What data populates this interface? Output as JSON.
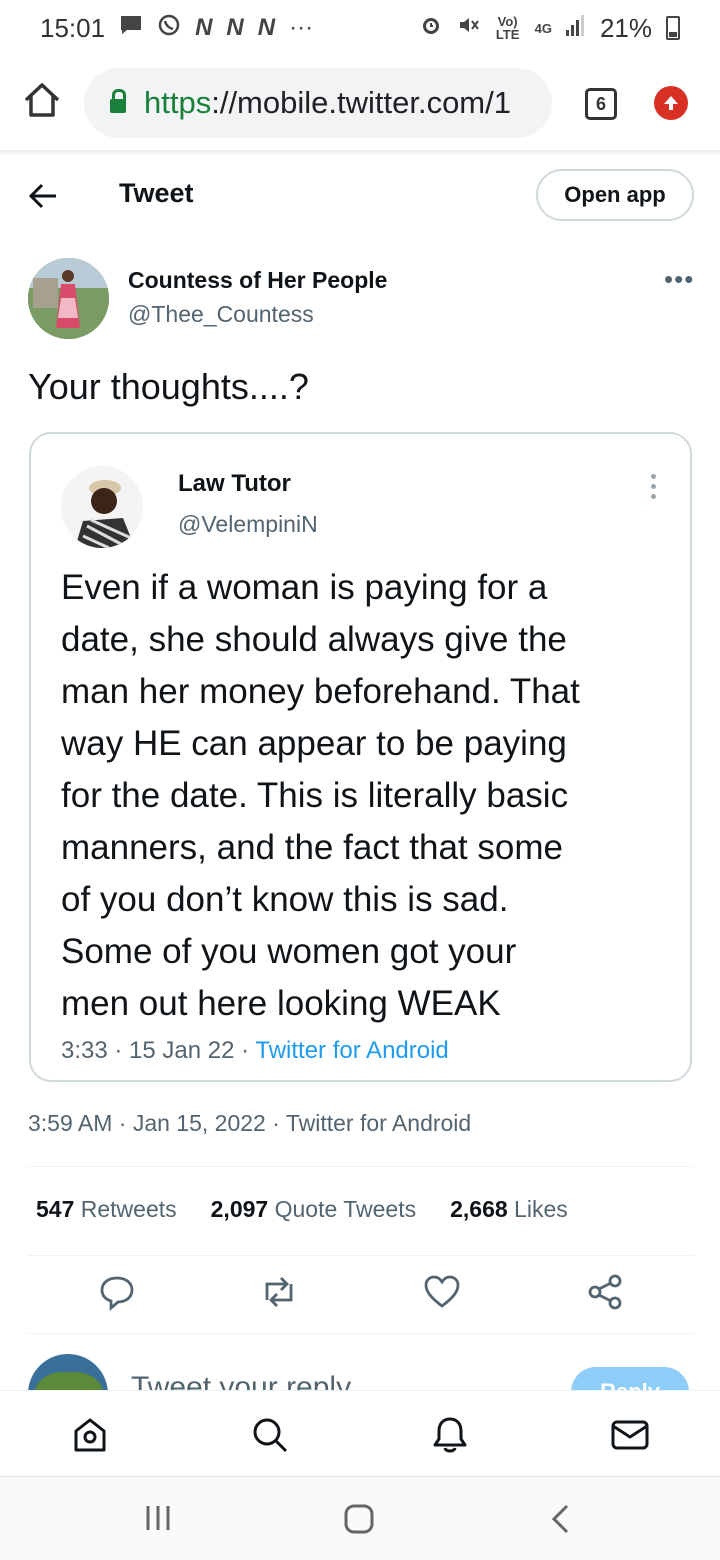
{
  "status_bar": {
    "time": "15:01",
    "battery": "21%",
    "network": "4G",
    "volte": "Vo) LTE"
  },
  "browser": {
    "url_scheme": "https",
    "url_rest": "://mobile.twitter.com/1",
    "tab_count": "6",
    "icons": [
      "home-icon",
      "lock-icon",
      "tabs-icon",
      "update-icon"
    ]
  },
  "header": {
    "title": "Tweet",
    "open_app": "Open app"
  },
  "tweet": {
    "author_name": "Countess of Her People",
    "author_handle": "@Thee_Countess",
    "text": "Your thoughts....?",
    "timestamp": "3:59 AM · Jan 15, 2022 · Twitter for Android"
  },
  "quoted": {
    "name": "Law Tutor",
    "handle": "@VelempiniN",
    "lines": [
      "Even if a woman is paying for a",
      "date, she should always give the",
      "man her money beforehand. That",
      "way HE can appear to be paying",
      "for the date. This is literally basic",
      "manners, and the fact that some",
      "of you don’t know this is sad.",
      "Some of you women got your",
      "men out here looking WEAK"
    ],
    "meta_time": "3:33 · 15 Jan 22 · ",
    "meta_source": "Twitter for Android"
  },
  "stats": {
    "retweets_count": "547",
    "retweets_label": "Retweets",
    "quotes_count": "2,097",
    "quotes_label": "Quote Tweets",
    "likes_count": "2,668",
    "likes_label": "Likes"
  },
  "reply": {
    "placeholder": "Tweet your reply",
    "button": "Reply"
  },
  "colors": {
    "accent": "#1d9bf0",
    "secure": "#188038",
    "update": "#d93025"
  }
}
